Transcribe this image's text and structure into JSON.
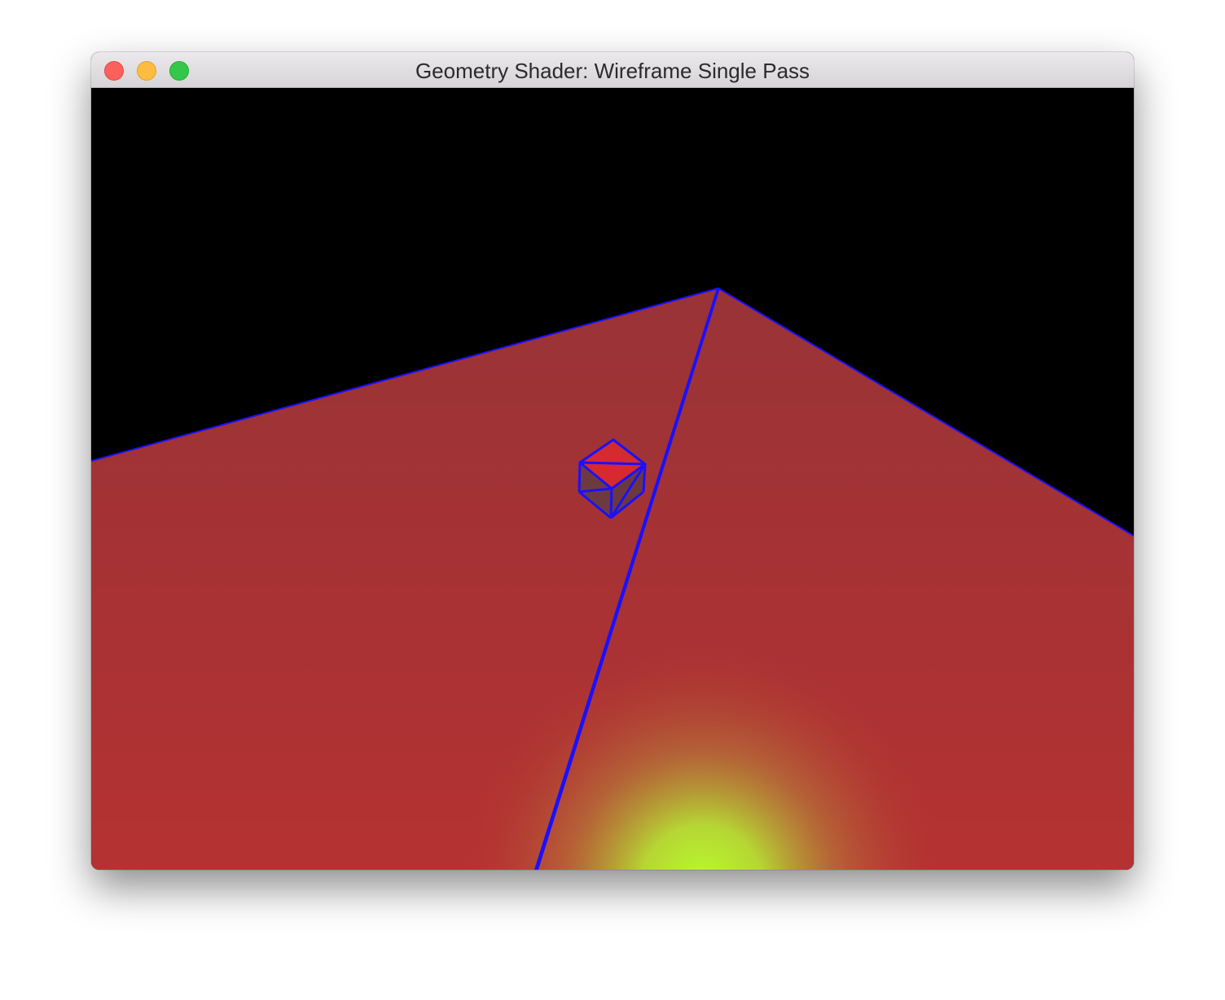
{
  "window": {
    "title": "Geometry Shader: Wireframe Single Pass",
    "controls": [
      "close",
      "minimize",
      "zoom"
    ]
  },
  "scene": {
    "background_color": "#000000",
    "plane_color": "#a83234",
    "wire_color": "#1a10ff",
    "glow_color": "#b8ff2a",
    "cube_top_color": "#d42b2f",
    "cube_side_color": "#6e3a42"
  }
}
